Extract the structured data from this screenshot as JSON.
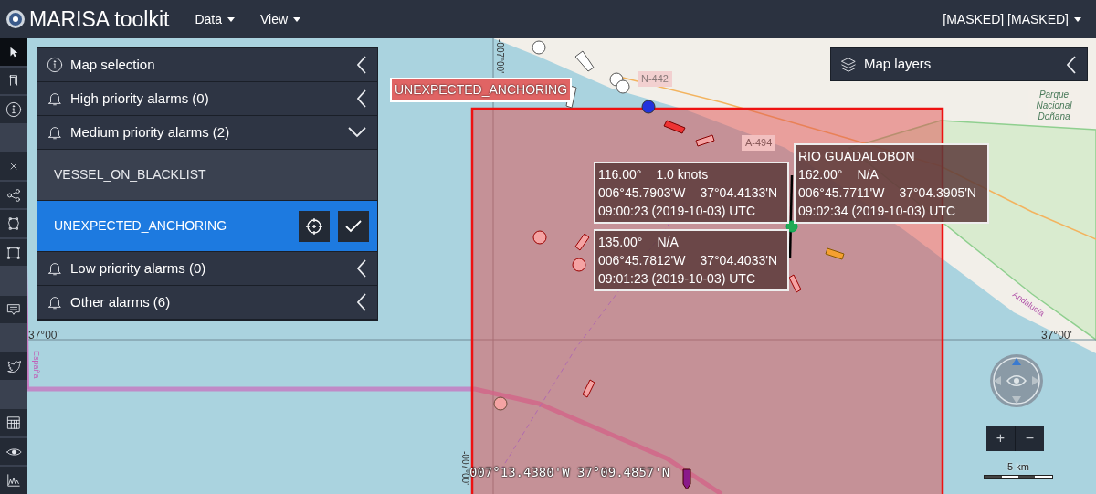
{
  "header": {
    "app_title": "MARISA toolkit",
    "menus": [
      {
        "label": "Data"
      },
      {
        "label": "View"
      }
    ],
    "user": "[MASKED] [MASKED]"
  },
  "toolbar": [
    {
      "kind": "pointer",
      "selected": true
    },
    {
      "kind": "bookmark",
      "selected": false
    },
    {
      "kind": "info",
      "selected": false
    },
    {
      "kind": "close",
      "selected": false
    },
    {
      "kind": "share",
      "selected": false
    },
    {
      "kind": "polygon",
      "selected": false
    },
    {
      "kind": "rectangle",
      "selected": false
    },
    {
      "kind": "comment",
      "selected": false
    },
    {
      "kind": "bird",
      "selected": false
    },
    {
      "kind": "table",
      "selected": false
    },
    {
      "kind": "eye",
      "selected": false
    },
    {
      "kind": "chart",
      "selected": false
    }
  ],
  "alarm_panel": [
    {
      "title": "Map selection",
      "expanded": false
    },
    {
      "title": "High priority alarms (0)",
      "expanded": false
    },
    {
      "title": "Medium priority alarms (2)",
      "expanded": true,
      "items": [
        {
          "label": "VESSEL_ON_BLACKLIST",
          "selected": false
        },
        {
          "label": "UNEXPECTED_ANCHORING",
          "selected": true
        }
      ]
    },
    {
      "title": "Low priority alarms (0)",
      "expanded": false
    },
    {
      "title": "Other alarms (6)",
      "expanded": false
    }
  ],
  "map_layers": {
    "title": "Map layers",
    "expanded": false
  },
  "map": {
    "alarm_label": "UNEXPECTED_ANCHORING",
    "labels": [
      "N-442",
      "A-494",
      "Parque Nacional Doñana",
      "España",
      "Andalucía"
    ],
    "grid_labels": [
      {
        "kind": "lat",
        "text": "37°00'"
      },
      {
        "kind": "lat",
        "text": "37°00'"
      },
      {
        "kind": "lon",
        "text": "-007°00'"
      },
      {
        "kind": "lon",
        "text": "-007°00'"
      }
    ],
    "vessel_popups": [
      {
        "lines": [
          [
            "116.00°",
            "1.0 knots"
          ],
          [
            "006°45.7903'W",
            "37°04.4133'N"
          ],
          [
            "09:00:23 (2019-10-03) UTC"
          ]
        ]
      },
      {
        "lines": [
          [
            "135.00°",
            "N/A"
          ],
          [
            "006°45.7812'W",
            "37°04.4033'N"
          ],
          [
            "09:01:23 (2019-10-03) UTC"
          ]
        ]
      },
      {
        "name": "RIO GUADALOBON",
        "lines": [
          [
            "162.00°",
            "N/A"
          ],
          [
            "006°45.7711'W",
            "37°04.3905'N"
          ],
          [
            "09:02:34 (2019-10-03) UTC"
          ]
        ]
      }
    ],
    "cursor_position": "007°13.4380'W 37°09.4857'N",
    "zoom_controls": [
      "+",
      "−"
    ],
    "scale": "5 km"
  }
}
